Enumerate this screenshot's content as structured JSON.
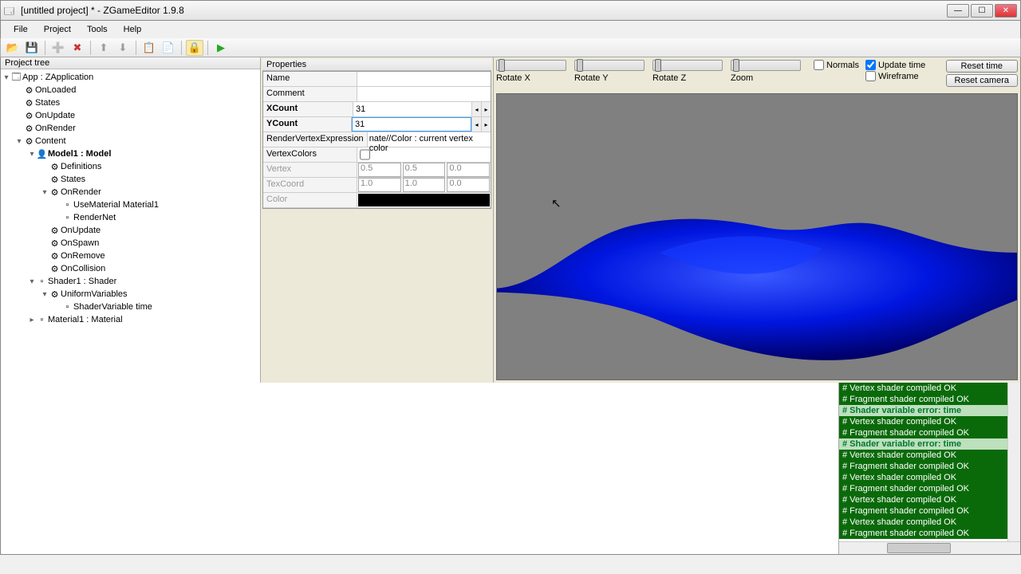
{
  "title": "[untitled project] * - ZGameEditor 1.9.8",
  "menu": {
    "file": "File",
    "project": "Project",
    "tools": "Tools",
    "help": "Help"
  },
  "toolbar_icons": {
    "open": "📂",
    "save": "💾",
    "add": "➕",
    "delete": "✖",
    "up": "⬆",
    "down": "⬇",
    "copy": "📋",
    "paste": "📄",
    "lock": "🔒",
    "run": "▶"
  },
  "tree_header": "Project tree",
  "tree": [
    {
      "depth": 0,
      "exp": "▾",
      "icon": "🗔",
      "label": "App : ZApplication"
    },
    {
      "depth": 1,
      "exp": "",
      "icon": "⚙",
      "label": "OnLoaded"
    },
    {
      "depth": 1,
      "exp": "",
      "icon": "⚙",
      "label": "States"
    },
    {
      "depth": 1,
      "exp": "",
      "icon": "⚙",
      "label": "OnUpdate"
    },
    {
      "depth": 1,
      "exp": "",
      "icon": "⚙",
      "label": "OnRender"
    },
    {
      "depth": 1,
      "exp": "▾",
      "icon": "⚙",
      "label": "Content"
    },
    {
      "depth": 2,
      "exp": "▾",
      "icon": "👤",
      "label": "Model1 : Model",
      "bold": true
    },
    {
      "depth": 3,
      "exp": "",
      "icon": "⚙",
      "label": "Definitions"
    },
    {
      "depth": 3,
      "exp": "",
      "icon": "⚙",
      "label": "States"
    },
    {
      "depth": 3,
      "exp": "▾",
      "icon": "⚙",
      "label": "OnRender"
    },
    {
      "depth": 4,
      "exp": "",
      "icon": "▫",
      "label": "UseMaterial  Material1"
    },
    {
      "depth": 4,
      "exp": "",
      "icon": "▫",
      "label": "RenderNet"
    },
    {
      "depth": 3,
      "exp": "",
      "icon": "⚙",
      "label": "OnUpdate"
    },
    {
      "depth": 3,
      "exp": "",
      "icon": "⚙",
      "label": "OnSpawn"
    },
    {
      "depth": 3,
      "exp": "",
      "icon": "⚙",
      "label": "OnRemove"
    },
    {
      "depth": 3,
      "exp": "",
      "icon": "⚙",
      "label": "OnCollision"
    },
    {
      "depth": 2,
      "exp": "▾",
      "icon": "▫",
      "label": "Shader1 : Shader"
    },
    {
      "depth": 3,
      "exp": "▾",
      "icon": "⚙",
      "label": "UniformVariables"
    },
    {
      "depth": 4,
      "exp": "",
      "icon": "▫",
      "label": "ShaderVariable  time"
    },
    {
      "depth": 2,
      "exp": "▸",
      "icon": "▫",
      "label": "Material1 : Material"
    }
  ],
  "props_header": "Properties",
  "props": {
    "name_label": "Name",
    "name_value": "",
    "comment_label": "Comment",
    "comment_value": "",
    "xcount_label": "XCount",
    "xcount_value": "31",
    "ycount_label": "YCount",
    "ycount_value": "31",
    "rve_label": "RenderVertexExpression",
    "rve_value": "nate//Color : current vertex color",
    "vc_label": "VertexColors",
    "vertex_label": "Vertex",
    "vertex": [
      "0.5",
      "0.5",
      "0.0"
    ],
    "texcoord_label": "TexCoord",
    "texcoord": [
      "1.0",
      "1.0",
      "0.0"
    ],
    "color_label": "Color",
    "color_value": "#000000"
  },
  "view3d": {
    "sliders": [
      "Rotate X",
      "Rotate Y",
      "Rotate Z",
      "Zoom"
    ],
    "normals": "Normals",
    "update_time": "Update time",
    "wireframe": "Wireframe",
    "reset_time": "Reset time",
    "reset_camera": "Reset camera"
  },
  "log": [
    {
      "t": "# Vertex shader compiled OK",
      "e": false
    },
    {
      "t": "# Fragment shader compiled OK",
      "e": false
    },
    {
      "t": "# Shader variable error: time",
      "e": true
    },
    {
      "t": "# Vertex shader compiled OK",
      "e": false
    },
    {
      "t": "# Fragment shader compiled OK",
      "e": false
    },
    {
      "t": "# Shader variable error: time",
      "e": true
    },
    {
      "t": "# Vertex shader compiled OK",
      "e": false
    },
    {
      "t": "# Fragment shader compiled OK",
      "e": false
    },
    {
      "t": "# Vertex shader compiled OK",
      "e": false
    },
    {
      "t": "# Fragment shader compiled OK",
      "e": false
    },
    {
      "t": "# Vertex shader compiled OK",
      "e": false
    },
    {
      "t": "# Fragment shader compiled OK",
      "e": false
    },
    {
      "t": "# Vertex shader compiled OK",
      "e": false
    },
    {
      "t": "# Fragment shader compiled OK",
      "e": false
    }
  ]
}
